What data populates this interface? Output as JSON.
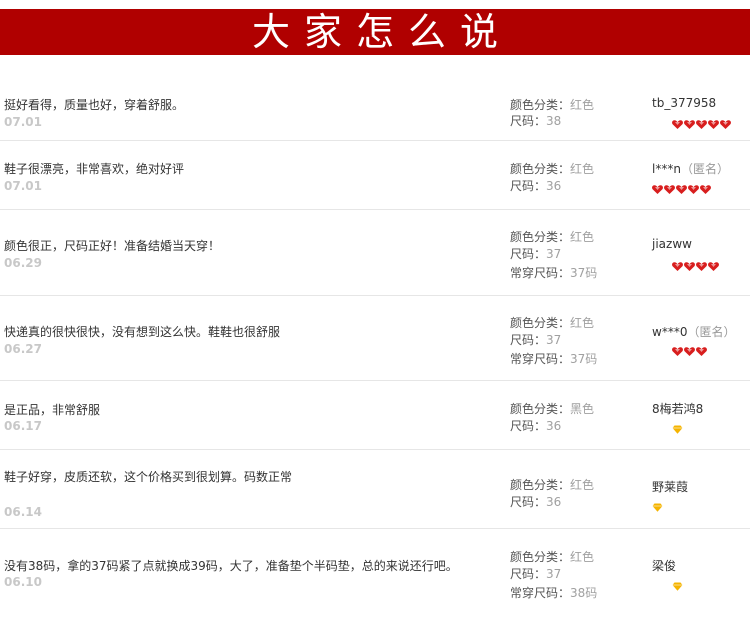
{
  "header": {
    "title": "大家怎么说"
  },
  "labels": {
    "color": "颜色分类：",
    "size": "尺码：",
    "usual_size": "常穿尺码："
  },
  "reviews": [
    {
      "text": "挺好看得，质量也好，穿着舒服。",
      "date": "07.01",
      "color": "红色",
      "size": "38",
      "usual": null,
      "user": "tb_377958",
      "anon": "",
      "rank_icon": "heart-icon",
      "rank_count": 5
    },
    {
      "text": "鞋子很漂亮，非常喜欢，绝对好评",
      "date": "07.01",
      "color": "红色",
      "size": "36",
      "usual": null,
      "user": "l***n",
      "anon": "（匿名）",
      "rank_icon": "heart-icon",
      "rank_count": 5
    },
    {
      "text": "颜色很正，尺码正好！准备结婚当天穿！",
      "date": "06.29",
      "color": "红色",
      "size": "37",
      "usual": "37码",
      "user": "jiazww",
      "anon": "",
      "rank_icon": "heart-icon",
      "rank_count": 4
    },
    {
      "text": "快递真的很快很快，没有想到这么快。鞋鞋也很舒服",
      "date": "06.27",
      "color": "红色",
      "size": "37",
      "usual": "37码",
      "user": "w***0",
      "anon": "（匿名）",
      "rank_icon": "heart-icon",
      "rank_count": 3
    },
    {
      "text": "是正品，非常舒服",
      "date": "06.17",
      "color": "黑色",
      "size": "36",
      "usual": null,
      "user": "8梅若鸿8",
      "anon": "",
      "rank_icon": "diamond-icon",
      "rank_count": 1
    },
    {
      "text": "鞋子好穿，皮质还软，这个价格买到很划算。码数正常",
      "date": "06.14",
      "color": "红色",
      "size": "36",
      "usual": null,
      "user": "野莱葭",
      "anon": "",
      "rank_icon": "diamond-icon",
      "rank_count": 1
    },
    {
      "text": "没有38码，拿的37码紧了点就换成39码，大了，准备垫个半码垫，总的来说还行吧。",
      "date": "06.10",
      "color": "红色",
      "size": "37",
      "usual": "38码",
      "user": "梁俊",
      "anon": "",
      "rank_icon": "diamond-icon",
      "rank_count": 1
    }
  ],
  "colors": {
    "banner": "#b00000",
    "heart": "#d81e1e",
    "diamond": "#f5b400"
  }
}
